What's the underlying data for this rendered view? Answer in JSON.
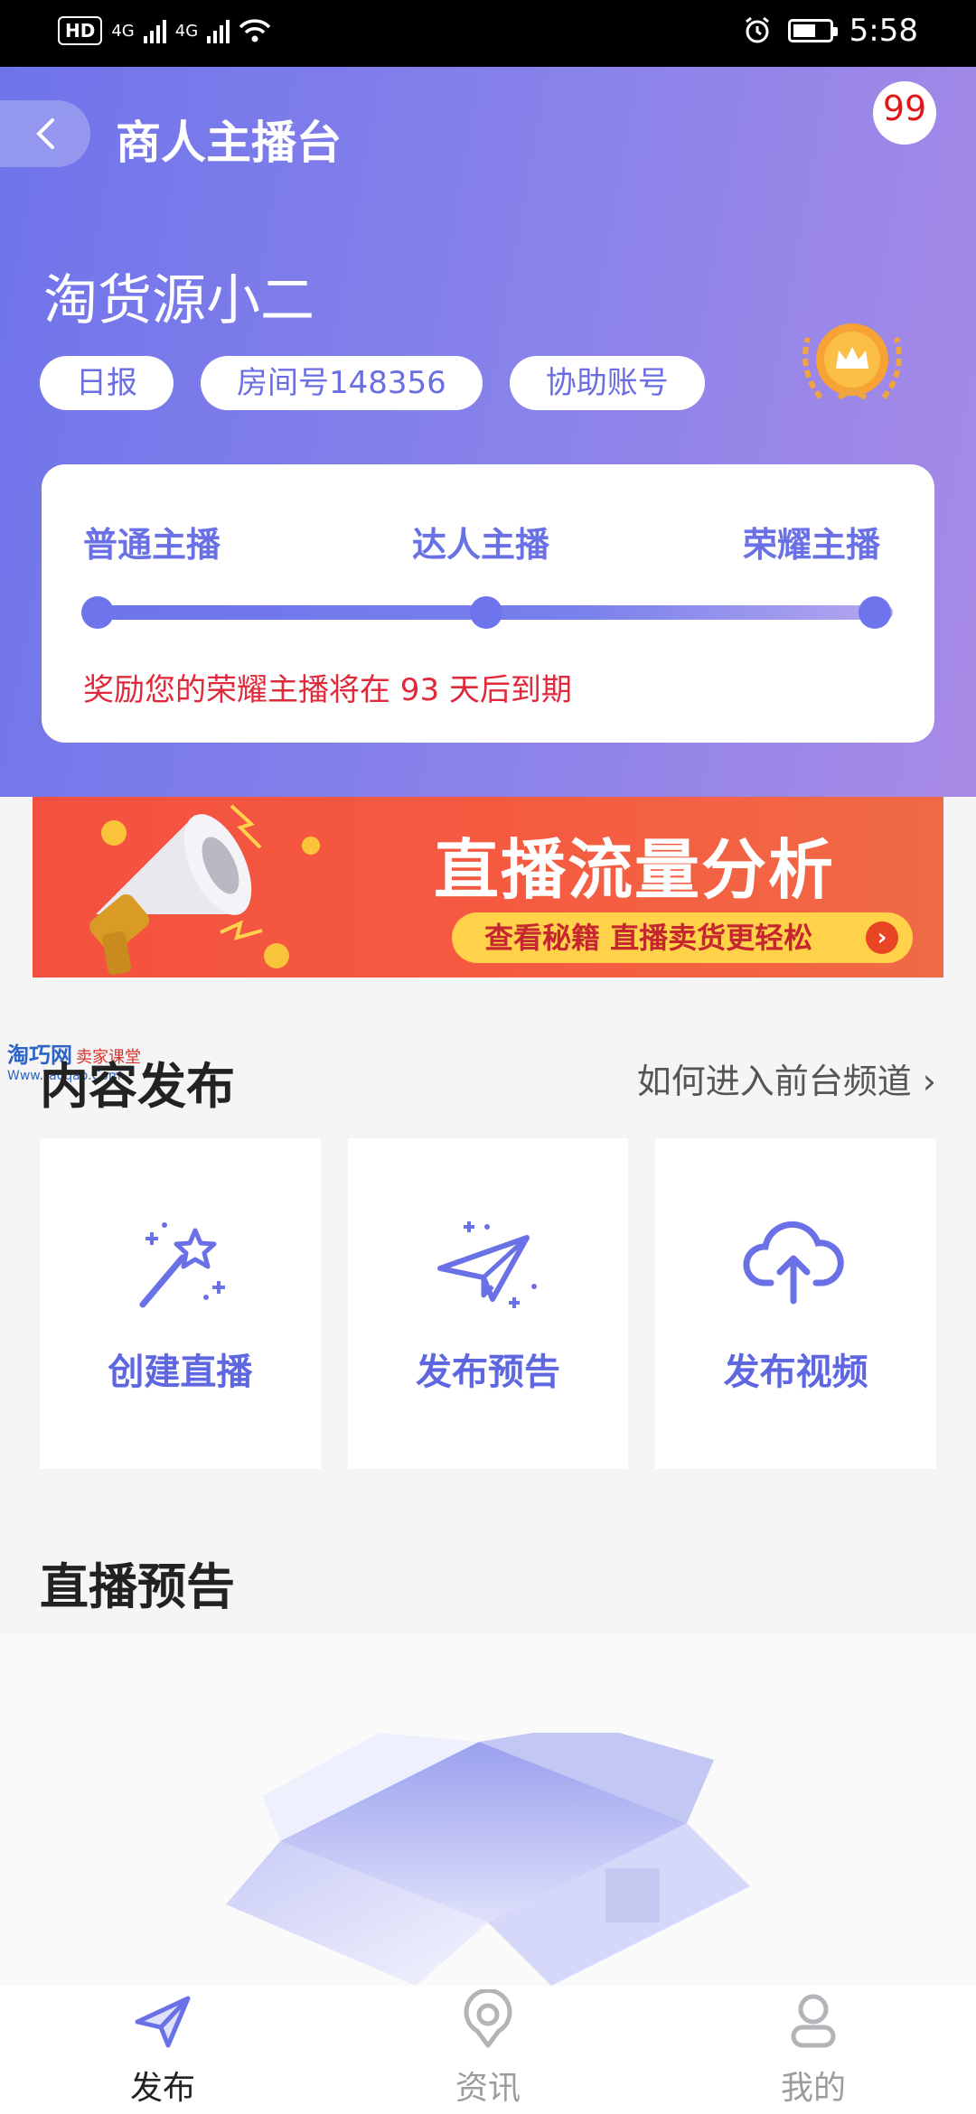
{
  "status_bar": {
    "hd": "HD",
    "net1": "4G",
    "net2": "4G",
    "time": "5:58"
  },
  "header": {
    "title": "商人主播台",
    "message_count": "99",
    "shop_name": "淘货源小二",
    "tags": [
      "日报",
      "房间号148356",
      "协助账号"
    ]
  },
  "level": {
    "labels": [
      "普通主播",
      "达人主播",
      "荣耀主播"
    ],
    "note": "奖励您的荣耀主播将在 93 天后到期"
  },
  "banner": {
    "title": "直播流量分析",
    "subtitle": "查看秘籍 直播卖货更轻松",
    "arrow": "›"
  },
  "watermark": {
    "brand": "淘巧网",
    "tag": "卖家课堂",
    "url": "Www.Taoqao.Com"
  },
  "content_publish": {
    "title": "内容发布",
    "link": "如何进入前台频道 ›",
    "actions": [
      {
        "label": "创建直播",
        "icon": "magic-wand-icon"
      },
      {
        "label": "发布预告",
        "icon": "paper-plane-icon"
      },
      {
        "label": "发布视频",
        "icon": "cloud-upload-icon"
      }
    ]
  },
  "live_preview": {
    "title": "直播预告"
  },
  "tabbar": {
    "items": [
      {
        "label": "发布",
        "icon": "paper-plane-icon",
        "active": true
      },
      {
        "label": "资讯",
        "icon": "location-pin-icon",
        "active": false
      },
      {
        "label": "我的",
        "icon": "user-icon",
        "active": false
      }
    ]
  },
  "colors": {
    "accent": "#6a70e6",
    "alert": "#e0293a",
    "banner": "#f3513f"
  }
}
